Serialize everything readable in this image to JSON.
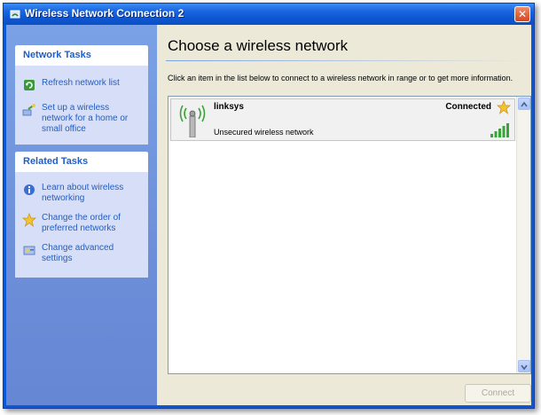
{
  "window": {
    "title": "Wireless Network Connection 2",
    "close_glyph": "✕"
  },
  "sidebar": {
    "network_tasks": {
      "header": "Network Tasks",
      "items": [
        {
          "label": "Refresh network list",
          "icon": "refresh-icon"
        },
        {
          "label": "Set up a wireless network for a home or small office",
          "icon": "setup-network-icon"
        }
      ]
    },
    "related_tasks": {
      "header": "Related Tasks",
      "items": [
        {
          "label": "Learn about wireless networking",
          "icon": "info-icon"
        },
        {
          "label": "Change the order of preferred networks",
          "icon": "star-icon"
        },
        {
          "label": "Change advanced settings",
          "icon": "settings-icon"
        }
      ]
    }
  },
  "main": {
    "heading": "Choose a wireless network",
    "instruction": "Click an item in the list below to connect to a wireless network in range or to get more information.",
    "networks": [
      {
        "name": "linksys",
        "status": "Connected",
        "security": "Unsecured wireless network",
        "signal_bars": 5
      }
    ],
    "connect_button": "Connect"
  },
  "colors": {
    "titlebar": "#0e55d1",
    "sidebar": "#6d8fd9",
    "task_link": "#215dc6",
    "window_bg": "#ece9d8"
  }
}
